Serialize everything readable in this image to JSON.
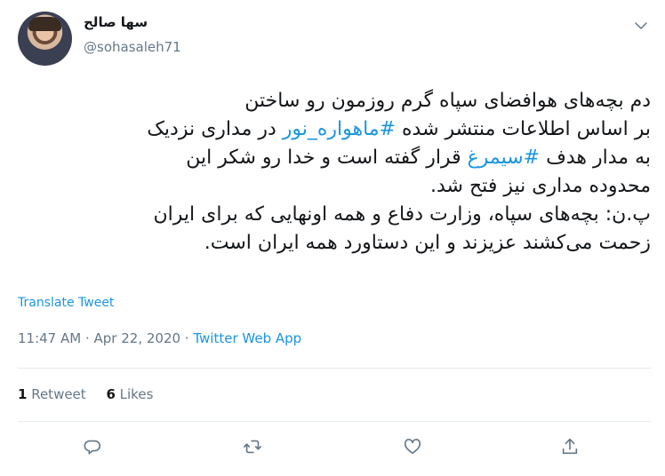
{
  "author": {
    "display_name": "سها صالح",
    "handle": "@sohasaleh71"
  },
  "tweet": {
    "lines": [
      [
        {
          "text": "دم بچه‌های هوافضای سپاه گرم روزمون رو ساختن",
          "tag": false
        }
      ],
      [
        {
          "text": "بر اساس اطلاعات منتشر شده ",
          "tag": false
        },
        {
          "text": "#ماهواره_نور",
          "tag": true
        },
        {
          "text": " در مداری نزدیک",
          "tag": false
        }
      ],
      [
        {
          "text": "به مدار هدف ",
          "tag": false
        },
        {
          "text": "#سیمرغ",
          "tag": true
        },
        {
          "text": " قرار گفته است و خدا رو شکر این",
          "tag": false
        }
      ],
      [
        {
          "text": "محدوده مداری نیز فتح شد.",
          "tag": false
        }
      ],
      [
        {
          "text": "پ.ن: بچه‌های سپاه، وزارت دفاع و همه اونهایی که برای ایران",
          "tag": false
        }
      ],
      [
        {
          "text": "زحمت می‌کشند عزیزند و این دستاورد همه ایران است.",
          "tag": false
        }
      ]
    ],
    "translate_label": "Translate Tweet"
  },
  "meta": {
    "time": "11:47 AM",
    "separator1": " · ",
    "date": "Apr 22, 2020",
    "separator2": " · ",
    "app": "Twitter Web App"
  },
  "stats": {
    "retweets_count": "1",
    "retweets_label": " Retweet",
    "likes_count": "6",
    "likes_label": " Likes"
  },
  "colors": {
    "link": "#1b95e0",
    "muted": "#657786",
    "text": "#14171a"
  },
  "icons": {
    "caret": "chevron-down-icon",
    "reply": "reply-icon",
    "retweet": "retweet-icon",
    "like": "heart-icon",
    "share": "share-icon"
  }
}
